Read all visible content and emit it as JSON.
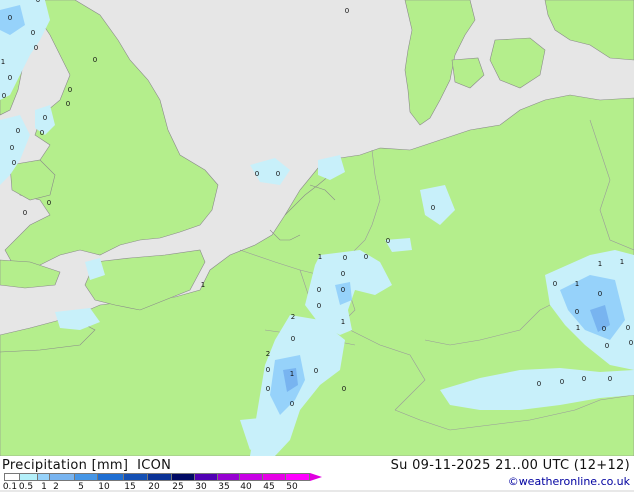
{
  "header": {
    "title_left": "Precipitation [mm]  ICON",
    "title_right": "Su 09-11-2025 21..00 UTC (12+12)",
    "credit": "©weatheronline.co.uk"
  },
  "legend": {
    "ticks": [
      "0.1",
      "0.5",
      "1",
      "2",
      "5",
      "10",
      "15",
      "20",
      "25",
      "30",
      "35",
      "40",
      "45",
      "50"
    ],
    "colors": [
      "#ffffff",
      "#b4f0fa",
      "#96d2fa",
      "#78b4f0",
      "#4696e6",
      "#1e6ed2",
      "#1450b4",
      "#0a3296",
      "#000a64",
      "#5000b4",
      "#9600d2",
      "#c800e6",
      "#e600e6",
      "#ff00ff"
    ]
  },
  "map": {
    "land_color": "#b4ee8c",
    "sea_color": "#e6e6e6",
    "precip_light": "#c8f0fa",
    "precip_medium": "#96d2fa",
    "precip_heavy": "#78b4f0",
    "values": [
      "0",
      "0",
      "0",
      "0",
      "1",
      "0",
      "0",
      "0",
      "0",
      "0",
      "0",
      "0",
      "0",
      "0",
      "0",
      "0",
      "0",
      "0",
      "0",
      "0",
      "0",
      "0",
      "1",
      "0",
      "0",
      "0",
      "0",
      "0",
      "0",
      "2",
      "1",
      "1",
      "1",
      "1",
      "0",
      "0",
      "1",
      "0",
      "0",
      "0",
      "0",
      "0",
      "0",
      "0",
      "0",
      "0",
      "2",
      "0",
      "0",
      "1",
      "0",
      "0",
      "0",
      "0",
      "1"
    ]
  }
}
